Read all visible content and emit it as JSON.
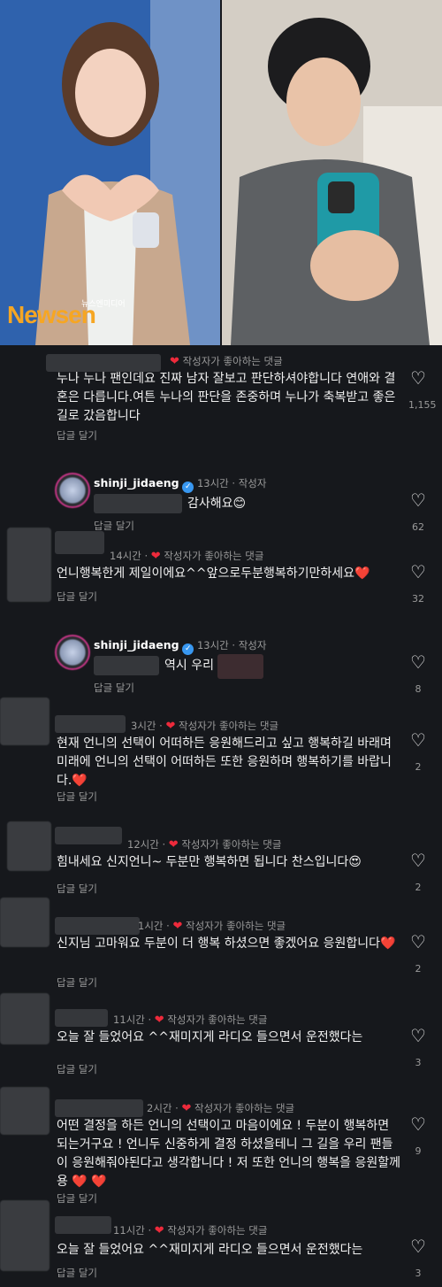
{
  "header": {
    "watermark_brand": "Newsen",
    "watermark_sub": "뉴스엔미디어"
  },
  "liked_label": "작성자가 좋아하는 댓글",
  "reply_label": "답글 달기",
  "comments": [
    {
      "time": "",
      "text": "누나 누나 팬인데요 진짜 남자 잘보고 판단하셔야합니다 연애와 결혼은 다릅니다.여튼 누나의 판단을 존중하며 누나가 축복받고 좋은 길로 갔음합니다",
      "likes": "1,155"
    },
    {
      "author": "shinji_jidaeng",
      "time": "13시간",
      "author_tag": "작성자",
      "text": "감사해요😊",
      "likes": "62"
    },
    {
      "time": "14시간",
      "text": "언니행복한게 제일이에요^^앞으로두분행복하기만하세요❤️",
      "likes": "32"
    },
    {
      "author": "shinji_jidaeng",
      "time": "13시간",
      "author_tag": "작성자",
      "text": "역시 우리",
      "likes": "8"
    },
    {
      "time": "3시간",
      "text": "현재 언니의 선택이 어떠하든 응원해드리고 싶고 행복하길 바래며 미래에 언니의 선택이 어떠하든 또한 응원하며 행복하기를 바랍니다.❤️",
      "likes": "2"
    },
    {
      "time": "12시간",
      "text": "힘내세요 신지언니~ 두분만 행복하면 됩니다 찬스입니다😍",
      "likes": "2"
    },
    {
      "time": "1시간",
      "text": "신지님 고마워요 두분이 더 행복 하셨으면 좋겠어요 응원합니다❤️",
      "likes": "2"
    },
    {
      "time": "11시간",
      "text": "오늘  잘 들었어요 ^^재미지게 라디오 들으면서 운전했다는",
      "likes": "3"
    },
    {
      "time": "2시간",
      "text": "어떤 결정을 하든 언니의 선택이고 마음이에요 ! 두분이 행복하면 되는거구요 ! 언니두 신중하게 결정 하셨을테니 그 길을 우리 팬들이 응원해줘야된다고 생각합니다 ! 저 또한 언니의 행복을 응원할께용 ❤️ ❤️",
      "likes": "9"
    },
    {
      "time": "11시간",
      "text": "오늘  잘 들었어요 ^^재미지게 라디오 들으면서 운전했다는",
      "likes": "3"
    }
  ]
}
